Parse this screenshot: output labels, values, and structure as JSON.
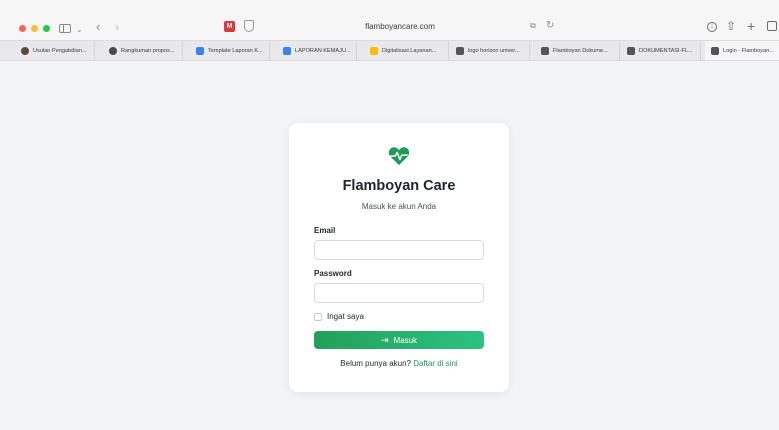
{
  "browser": {
    "url": "flamboyancare.com",
    "favicon_letter": "M",
    "tabs": [
      {
        "label": "Usulan Pengabdian...",
        "color": "#5c4a3a"
      },
      {
        "label": "Rangkuman propos...",
        "color": "#4a4a4a"
      },
      {
        "label": "Template Laporan K...",
        "color": "#3b82f6"
      },
      {
        "label": "LAPORAN KEMAJU...",
        "color": "#3b82f6"
      },
      {
        "label": "Digitalisasi Layanan...",
        "color": "#fbbc04"
      },
      {
        "label": "logo horizon univer...",
        "color": "#555555"
      },
      {
        "label": "Flamboyan Dokume...",
        "color": "#555555"
      },
      {
        "label": "DOKUMENTASI-FL...",
        "color": "#555555"
      },
      {
        "label": "Login - Flamboyan...",
        "color": "#555555"
      }
    ]
  },
  "login": {
    "icon": "heart-pulse-icon",
    "title": "Flamboyan Care",
    "subtitle": "Masuk ke akun Anda",
    "email_label": "Email",
    "email_value": "",
    "password_label": "Password",
    "password_value": "",
    "remember_label": "Ingat saya",
    "submit_label": "Masuk",
    "footer_text": "Belum punya akun?",
    "register_link": "Daftar di sini"
  },
  "colors": {
    "brand_green": "#1e9b56",
    "button_start": "#22a05a",
    "button_end": "#2dc282"
  }
}
